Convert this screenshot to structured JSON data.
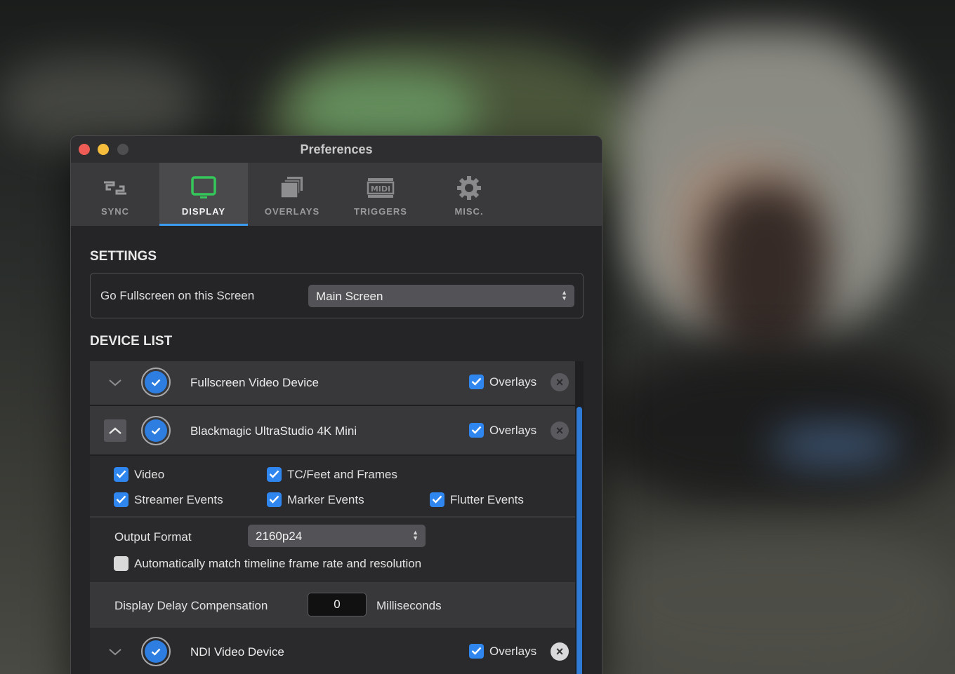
{
  "window": {
    "title": "Preferences"
  },
  "tabs": [
    {
      "label": "SYNC",
      "icon": "sync-icon",
      "active": false
    },
    {
      "label": "DISPLAY",
      "icon": "monitor-icon",
      "active": true
    },
    {
      "label": "OVERLAYS",
      "icon": "layers-icon",
      "active": false
    },
    {
      "label": "TRIGGERS",
      "icon": "midi-icon",
      "active": false
    },
    {
      "label": "MISC.",
      "icon": "gear-icon",
      "active": false
    }
  ],
  "settings": {
    "heading": "SETTINGS",
    "fullscreen_label": "Go Fullscreen on this Screen",
    "fullscreen_value": "Main Screen"
  },
  "device_list": {
    "heading": "DEVICE LIST",
    "devices": [
      {
        "name": "Fullscreen Video Device",
        "overlays_label": "Overlays",
        "overlays": true,
        "enabled": true,
        "expanded": false
      },
      {
        "name": "Blackmagic UltraStudio 4K Mini",
        "overlays_label": "Overlays",
        "overlays": true,
        "enabled": true,
        "expanded": true
      },
      {
        "name": "NDI Video Device",
        "overlays_label": "Overlays",
        "overlays": true,
        "enabled": true,
        "expanded": false
      }
    ],
    "options": {
      "video": "Video",
      "tc_feet_frames": "TC/Feet and Frames",
      "streamer_events": "Streamer Events",
      "marker_events": "Marker Events",
      "flutter_events": "Flutter Events"
    },
    "output_format_label": "Output Format",
    "output_format_value": "2160p24",
    "auto_match_label": "Automatically match timeline frame rate and resolution",
    "auto_match_checked": false,
    "delay_label": "Display Delay Compensation",
    "delay_value": "0",
    "delay_unit": "Milliseconds"
  },
  "colors": {
    "accent": "#2f86ee",
    "active_tab_underline": "#3a9bf0"
  }
}
